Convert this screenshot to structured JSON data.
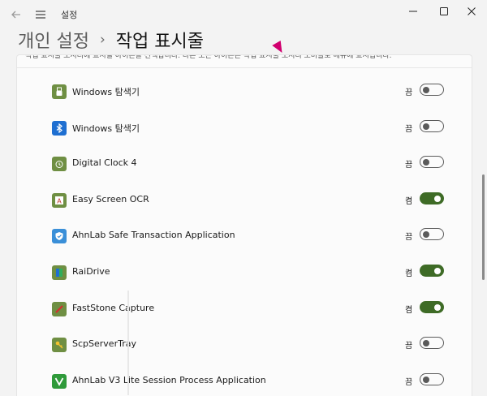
{
  "window": {
    "app_title": "설정",
    "back_icon": "back-arrow-icon",
    "menu_icon": "hamburger-menu-icon",
    "controls": [
      "minimize-icon",
      "maximize-icon",
      "close-icon"
    ]
  },
  "breadcrumb": {
    "parent": "개인 설정",
    "separator": "›",
    "current": "작업 표시줄"
  },
  "description": "작업 표시줄 모서리에 표시될 아이콘을 선택합니다. 다른 모든 아이콘은 작업 표시줄 모서리 오버플로 메뉴에 표시됩니다.",
  "items": [
    {
      "name": "Windows 탐색기",
      "state": "끔",
      "on": false,
      "icon": "usb-drive-icon",
      "color": "#6f8f43"
    },
    {
      "name": "Windows 탐색기",
      "state": "끔",
      "on": false,
      "icon": "bluetooth-icon",
      "color": "#1f6fd1"
    },
    {
      "name": "Digital Clock 4",
      "state": "끔",
      "on": false,
      "icon": "alarm-clock-icon",
      "color": "#6f8f43"
    },
    {
      "name": "Easy Screen OCR",
      "state": "켬",
      "on": true,
      "icon": "ocr-icon",
      "color": "#6f8f43"
    },
    {
      "name": "AhnLab Safe Transaction Application",
      "state": "끔",
      "on": false,
      "icon": "shield-icon",
      "color": "#3a8fd8"
    },
    {
      "name": "RaiDrive",
      "state": "켬",
      "on": true,
      "icon": "drive-icon",
      "color": "#6f8f43"
    },
    {
      "name": "FastStone Capture",
      "state": "켬",
      "on": true,
      "icon": "capture-icon",
      "color": "#6f8f43"
    },
    {
      "name": "ScpServerTray",
      "state": "끔",
      "on": false,
      "icon": "key-icon",
      "color": "#6f8f43"
    },
    {
      "name": "AhnLab V3 Lite Session Process Application",
      "state": "끔",
      "on": false,
      "icon": "v3-icon",
      "color": "#2f9a3a"
    }
  ]
}
